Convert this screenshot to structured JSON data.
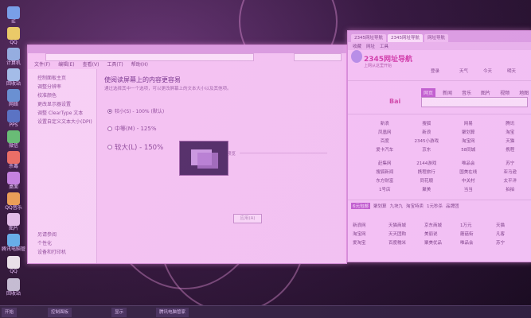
{
  "desktop_icons": [
    "IE",
    "QQ",
    "计算机",
    "回收站",
    "网络",
    "PPS",
    "微信",
    "杀毒",
    "桌面",
    "QQ音乐",
    "图片",
    "腾讯电脑管家",
    "QQ",
    "回收站"
  ],
  "left_window": {
    "menu": [
      "文件(F)",
      "编辑(E)",
      "查看(V)",
      "工具(T)",
      "帮助(H)"
    ],
    "sidebar": [
      "控制面板主页",
      "调整分辨率",
      "校准颜色",
      "更改显示器设置",
      "调整 ClearType 文本",
      "设置自定义文本大小(DPI)"
    ],
    "sidebar_bottom": [
      "另请参阅",
      "个性化",
      "设备和打印机"
    ],
    "title": "使阅读屏幕上的内容更容易",
    "description": "通过选择其中一个选项，可以更改屏幕上的文本大小以及其他项。",
    "preview_label": "预览",
    "options": [
      {
        "label": "较小(S) - 100% (默认)",
        "selected": true
      },
      {
        "label": "中等(M) - 125%",
        "selected": false
      },
      {
        "label": "较大(L) - 150%",
        "selected": false
      }
    ],
    "apply_label": "应用(A)"
  },
  "right_window": {
    "tabs": [
      "2345网址导航",
      "2345网址导航",
      "网址导航"
    ],
    "toolbar": [
      "收藏",
      "网址",
      "工具"
    ],
    "logo": "2345网址导航",
    "logo_sub": "上网从这里开始",
    "header_items": [
      "登录",
      "天气",
      "今天",
      "明天"
    ],
    "search_engine": "Bai",
    "search_tabs": [
      "网页",
      "新闻",
      "音乐",
      "图片",
      "视频",
      "地图"
    ],
    "grid": [
      [
        "新浪",
        "搜狐",
        "网易",
        "腾讯"
      ],
      [
        "凤凰网",
        "新浪",
        "聚划算",
        "淘宝"
      ],
      [
        "百度",
        "2345小游戏",
        "淘宝网",
        "天猫"
      ],
      [
        "爱卡汽车",
        "京东",
        "58同城",
        "携程"
      ],
      [
        "赶集网",
        "2144游戏",
        "唯品会",
        "苏宁"
      ],
      [
        "搜狐新闻",
        "携程旅行",
        "国美在线",
        "亚马逊"
      ],
      [
        "东方财富",
        "同花顺",
        "中关村",
        "太平洋"
      ],
      [
        "1号店",
        "聚美",
        "当当",
        "拍拍"
      ]
    ],
    "bottom_tabs": [
      "6元包邮",
      "聚划算",
      "九块九",
      "淘宝特卖",
      "1元秒杀",
      "品牌团"
    ],
    "bottom_grid": [
      [
        "新浪网",
        "天猫商城",
        "京东商城",
        "1万元",
        "天猫"
      ],
      [
        "淘宝网",
        "天天团购",
        "美丽说",
        "蘑菇街",
        "凡客"
      ],
      [
        "爱淘宝",
        "百度糯米",
        "聚美优品",
        "唯品会",
        "苏宁"
      ]
    ]
  },
  "taskbar": [
    "开始",
    "控制面板",
    "显示",
    "腾讯电脑管家"
  ]
}
